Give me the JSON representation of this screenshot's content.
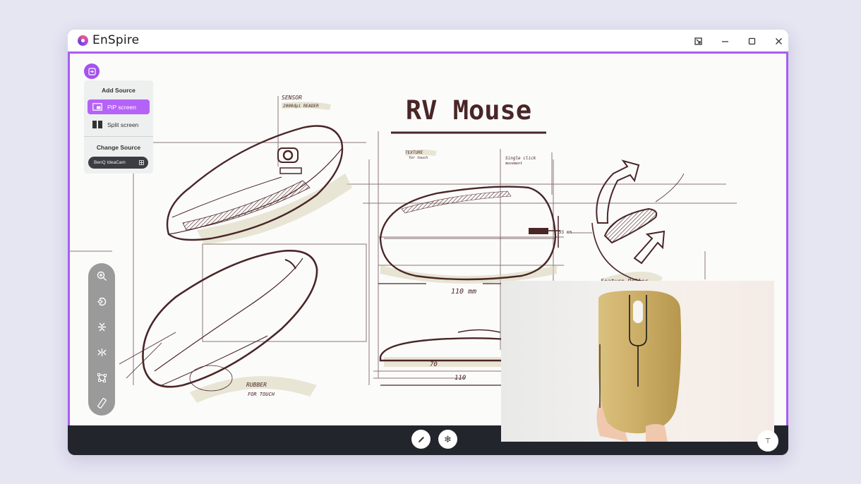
{
  "app": {
    "title": "EnSpire",
    "logo_icon": "enspire-logo-icon",
    "accent_color": "#a85ef2"
  },
  "window_controls": [
    {
      "name": "shrink-window-button",
      "icon": "shrink-icon",
      "glyph": "⧅"
    },
    {
      "name": "minimize-button",
      "icon": "minimize-icon",
      "glyph": "—"
    },
    {
      "name": "maximize-button",
      "icon": "maximize-icon",
      "glyph": "▢"
    },
    {
      "name": "close-button",
      "icon": "close-icon",
      "glyph": "✕"
    }
  ],
  "source_panel": {
    "add_source_heading": "Add Source",
    "pip_label": "PiP screen",
    "split_label": "Split screen",
    "change_source_heading": "Change Source",
    "camera_selected": "BenQ IdeaCam",
    "selected_option": "PiP screen"
  },
  "side_toolbar": [
    {
      "name": "zoom-in-tool",
      "icon": "zoom-in-icon"
    },
    {
      "name": "rotate-tool",
      "icon": "rotate-icon"
    },
    {
      "name": "flip-vertical-tool",
      "icon": "flip-vertical-icon"
    },
    {
      "name": "flip-horizontal-tool",
      "icon": "flip-horizontal-icon"
    },
    {
      "name": "crop-transform-tool",
      "icon": "transform-icon"
    },
    {
      "name": "ruler-tool",
      "icon": "ruler-icon"
    }
  ],
  "sketch": {
    "title": "RV Mouse",
    "annotations": {
      "sensor": "SENSOR",
      "sensor_sub": "2000dpi READER",
      "single_click": "Single click",
      "single_click_sub": "movement",
      "texture": "TEXTURE",
      "texture_sub": "for touch",
      "width_dim": "110 mm",
      "height_dim": "55 mm",
      "side_dim_1": "70",
      "side_dim_2": "110",
      "feature_roller": "Feature Roller",
      "rubber": "RUBBER",
      "rubber_sub": "FOR TOUCH"
    },
    "ink_color": "#4a2626"
  },
  "bottom_bar": {
    "pen_icon": "✎",
    "freeze_icon": "❄",
    "pip_handle_icon": "⊤"
  }
}
